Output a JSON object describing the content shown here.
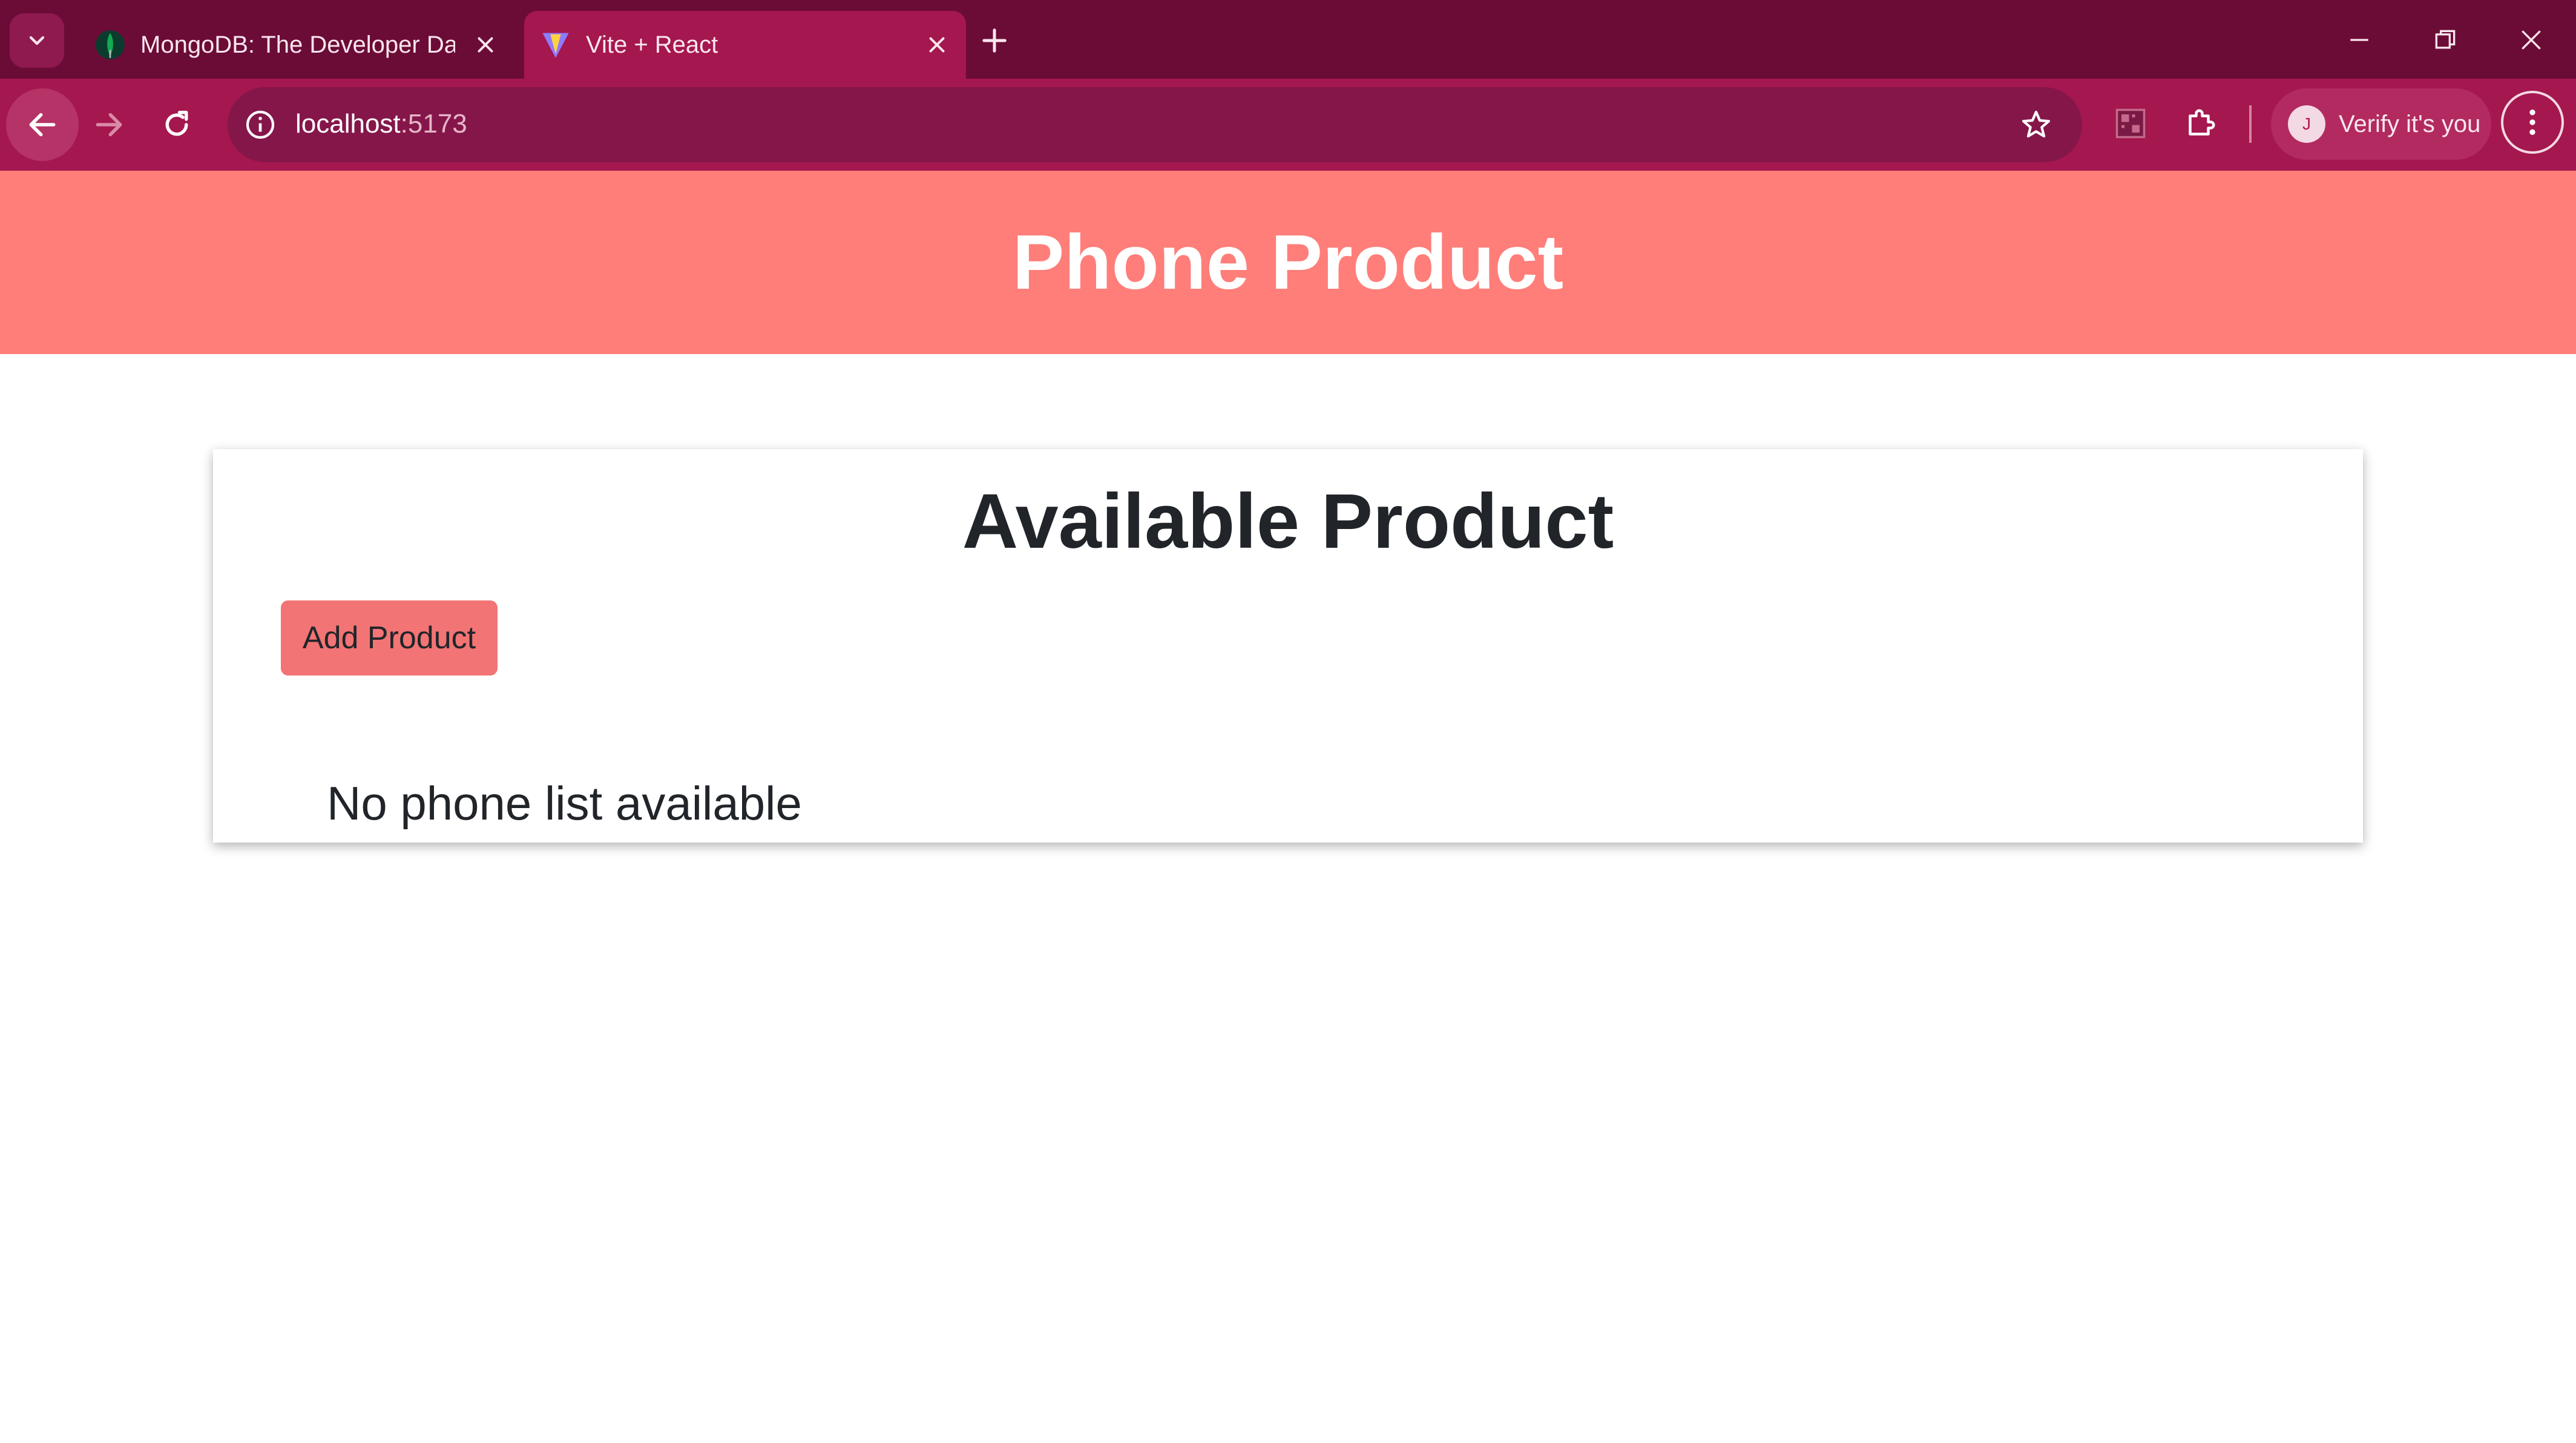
{
  "browser": {
    "tabs": [
      {
        "title": "MongoDB: The Developer Data",
        "favicon": "mongodb-leaf-icon",
        "active": false
      },
      {
        "title": "Vite + React",
        "favicon": "vite-icon",
        "active": true
      }
    ],
    "url_host": "localhost",
    "url_port": ":5173",
    "profile_button": {
      "avatar_initial": "J",
      "label": "Verify it's you"
    },
    "colors": {
      "tabstrip": "#6b0c36",
      "toolbar": "#a5174f",
      "omnibox": "#85164a"
    }
  },
  "page": {
    "header_title": "Phone Product",
    "section_title": "Available Product",
    "add_button_label": "Add Product",
    "empty_message": "No phone list available",
    "colors": {
      "header_bg": "#ff7e79",
      "button_bg": "#f27474",
      "text": "#212529"
    }
  }
}
